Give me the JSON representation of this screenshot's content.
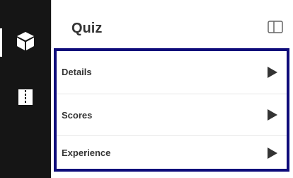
{
  "panel": {
    "title": "Quiz"
  },
  "rail": {
    "items": [
      {
        "icon": "cube-icon",
        "active": true
      },
      {
        "icon": "split-page-icon",
        "active": false
      }
    ]
  },
  "sections": [
    {
      "label": "Details",
      "icon": "play-arrow-icon"
    },
    {
      "label": "Scores",
      "icon": "play-arrow-icon"
    },
    {
      "label": "Experience",
      "icon": "play-arrow-icon"
    }
  ],
  "colors": {
    "rail_bg": "#151515",
    "focus_border": "#0e0b7a",
    "text": "#333333"
  }
}
